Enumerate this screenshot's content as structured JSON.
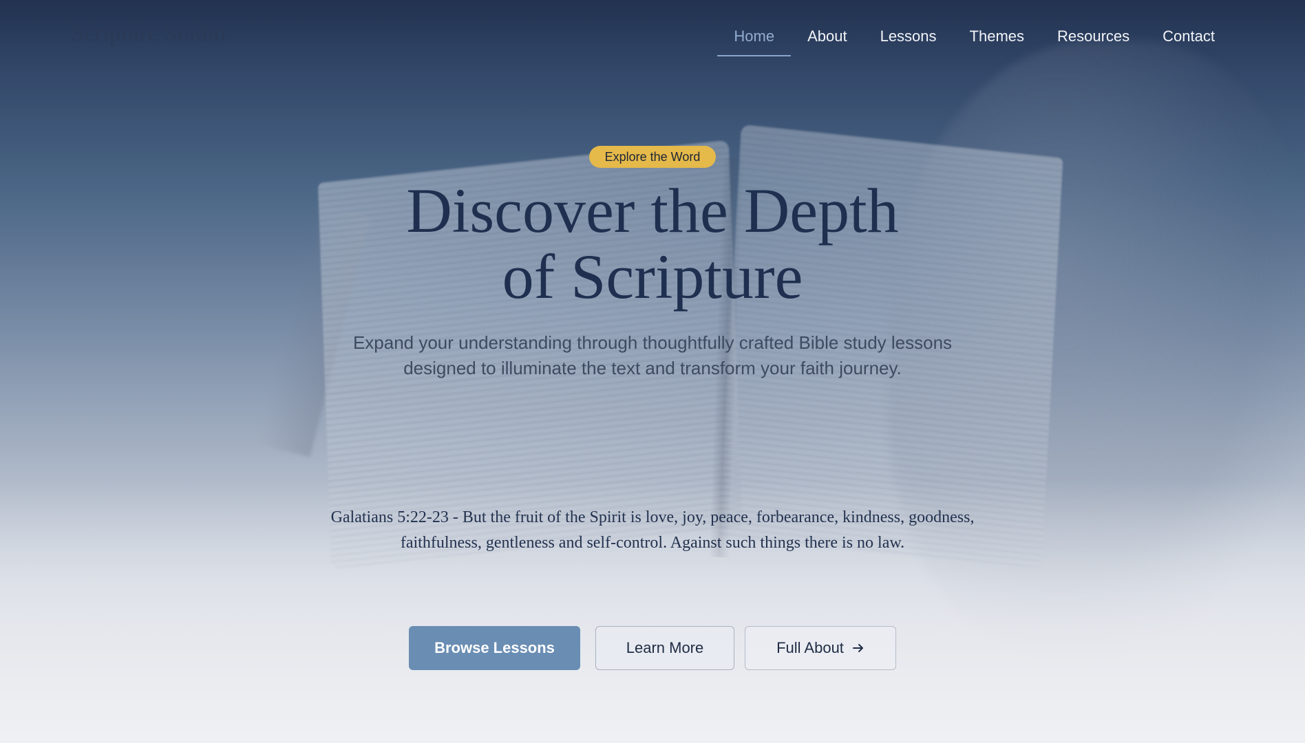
{
  "brand": {
    "name": "Scripture Studio"
  },
  "nav": {
    "items": [
      {
        "label": "Home",
        "active": true
      },
      {
        "label": "About",
        "active": false
      },
      {
        "label": "Lessons",
        "active": false
      },
      {
        "label": "Themes",
        "active": false
      },
      {
        "label": "Resources",
        "active": false
      },
      {
        "label": "Contact",
        "active": false
      }
    ]
  },
  "hero": {
    "badge": "Explore the Word",
    "headline_line1": "Discover the Depth",
    "headline_line2": "of Scripture",
    "subtitle": "Expand your understanding through thoughtfully crafted Bible study lessons designed to illuminate the text and transform your faith journey.",
    "verse": "Galatians 5:22-23 - But the fruit of the Spirit is love, joy, peace, forbearance, kindness, goodness, faithfulness, gentleness and self-control. Against such things there is no law."
  },
  "buttons": {
    "browse": "Browse Lessons",
    "learn_more": "Learn More",
    "full_about": "Full About"
  },
  "icons": {
    "full_about_icon": "arrow-right-icon"
  },
  "colors": {
    "accent_badge": "#e5b94a",
    "primary_button": "#6a8db3",
    "headline": "#1e2f4f",
    "nav_active": "#93add0"
  }
}
